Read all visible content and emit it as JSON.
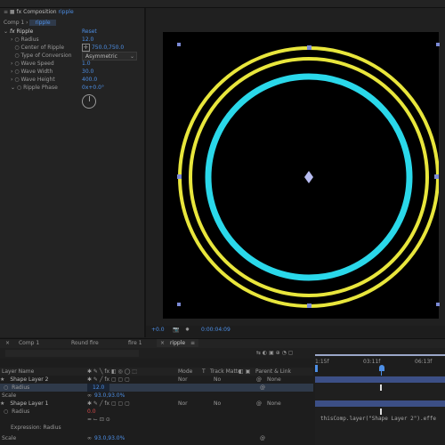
{
  "effect_controls": {
    "panel_title": "Composition",
    "panel_comp": "ripple",
    "tab_comp": "Comp 1",
    "tab_active": "ripple",
    "effect_name": "Ripple",
    "reset": "Reset",
    "params": [
      {
        "label": "Radius",
        "value": "12.0"
      },
      {
        "label": "Center of Ripple",
        "value": "750.0,750.0"
      },
      {
        "label": "Type of Conversion",
        "value": "Asymmetric"
      },
      {
        "label": "Wave Speed",
        "value": "1.0"
      },
      {
        "label": "Wave Width",
        "value": "30.0"
      },
      {
        "label": "Wave Height",
        "value": "400.0"
      },
      {
        "label": "Ripple Phase",
        "value": "0x+0.0°"
      }
    ]
  },
  "viewer": {
    "footer_zoom": "+0.0",
    "footer_time": "0:00:04:09"
  },
  "timeline_tabs": [
    {
      "label": "Comp 1",
      "active": false
    },
    {
      "label": "Round fire",
      "active": false
    },
    {
      "label": "fire 1",
      "active": false
    },
    {
      "label": "ripple",
      "active": true
    }
  ],
  "timeline": {
    "col_layer_name": "Layer Name",
    "col_mode": "Mode",
    "col_t": "T",
    "col_trkmat": "Track Matte",
    "col_parent": "Parent & Link",
    "ruler": [
      "1:15f",
      "03:11f",
      "06:13f"
    ],
    "layers": [
      {
        "name": "Shape Layer 2",
        "mode": "Nor",
        "trk": "No",
        "parent": "None",
        "props": [
          {
            "name": "Radius",
            "value": "12.0"
          },
          {
            "name": "Scale",
            "value": "93.0,93.0%"
          }
        ]
      },
      {
        "name": "Shape Layer 1",
        "mode": "Nor",
        "trk": "No",
        "parent": "None",
        "props": [
          {
            "name": "Radius",
            "value": "0.0"
          },
          {
            "name": "Expression: Radius",
            "value": ""
          },
          {
            "name": "Scale",
            "value": "93.0,93.0%"
          }
        ]
      }
    ],
    "expression": "thisComp.layer(\"Shape Layer 2\").effe"
  }
}
